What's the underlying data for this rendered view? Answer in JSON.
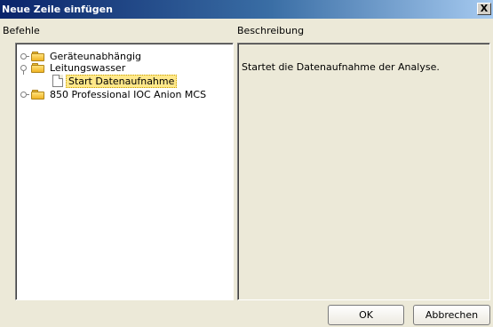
{
  "window": {
    "title": "Neue Zeile einfügen",
    "close_symbol": "X"
  },
  "labels": {
    "commands": "Befehle",
    "description": "Beschreibung"
  },
  "tree": {
    "items": [
      {
        "label": "Geräteunabhängig",
        "icon": "folder-icon",
        "expanded": false
      },
      {
        "label": "Leitungswasser",
        "icon": "folder-icon",
        "expanded": true,
        "children": [
          {
            "label": "Start Datenaufnahme",
            "icon": "document-icon",
            "selected": true
          }
        ]
      },
      {
        "label": "850 Professional IOC Anion MCS",
        "icon": "folder-icon",
        "expanded": false
      }
    ]
  },
  "description": {
    "text": "Startet die Datenaufnahme der Analyse."
  },
  "buttons": {
    "ok": "OK",
    "cancel": "Abbrechen"
  },
  "colors": {
    "titlebar_start": "#0a246a",
    "titlebar_end": "#a6caf0",
    "dialog_background": "#ece9d8",
    "selection": "#ffe88a"
  }
}
